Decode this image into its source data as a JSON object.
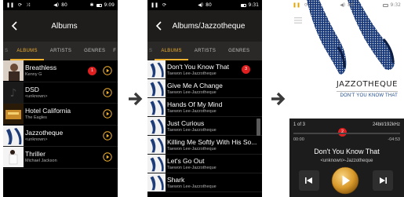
{
  "status": {
    "volume": "80",
    "time1": "9:09",
    "time2": "9:31",
    "time3": "9:32"
  },
  "screen1": {
    "title": "Albums",
    "tabs": [
      "ALBUMS",
      "ARTISTS",
      "GENRES",
      "F"
    ],
    "tab_left_fragment": "S",
    "badge": "1",
    "rows": [
      {
        "title": "Breathless",
        "subtitle": "Kenny G"
      },
      {
        "title": "DSD",
        "subtitle": "<unknown>"
      },
      {
        "title": "Hotel California",
        "subtitle": "The Eagles"
      },
      {
        "title": "Jazzotheque",
        "subtitle": "<unknown>"
      },
      {
        "title": "Thriller",
        "subtitle": "Michael Jackson"
      }
    ]
  },
  "screen2": {
    "title": "Albums/Jazzotheque",
    "tabs": [
      "ALBUMS",
      "ARTISTS",
      "GENRES"
    ],
    "tab_left_fragment": "S",
    "badge": "3",
    "rows": [
      {
        "title": "Don't You Know That",
        "subtitle": "Taewon Lee-Jazzotheque"
      },
      {
        "title": "Give Me A Change",
        "subtitle": "Taewon Lee-Jazzotheque"
      },
      {
        "title": "Hands Of My Mind",
        "subtitle": "Taewon Lee-Jazzotheque"
      },
      {
        "title": "Just Curious",
        "subtitle": "Taewon Lee-Jazzotheque"
      },
      {
        "title": "Killing Me Softly With His So...",
        "subtitle": "Taewon Lee-Jazzotheque"
      },
      {
        "title": "Let's Go Out",
        "subtitle": "Taewon Lee-Jazzotheque"
      },
      {
        "title": "Shark",
        "subtitle": "Taewon Lee-Jazzotheque"
      }
    ]
  },
  "screen3": {
    "brand": "JAZZOTHEQUE",
    "brand_sub": "DON'T YOU KNOW THAT",
    "track_index": "1 of 3",
    "quality": "24bit/192kHz",
    "badge": "2",
    "elapsed": "00:00",
    "remaining": "-04:53",
    "progress": 0.0,
    "track_title": "Don't You Know That",
    "track_subtitle": "<unknown>-Jazzotheque"
  },
  "colors": {
    "accent": "#f0b030",
    "badge": "#e02020",
    "link_blue": "#1e4b8c"
  }
}
